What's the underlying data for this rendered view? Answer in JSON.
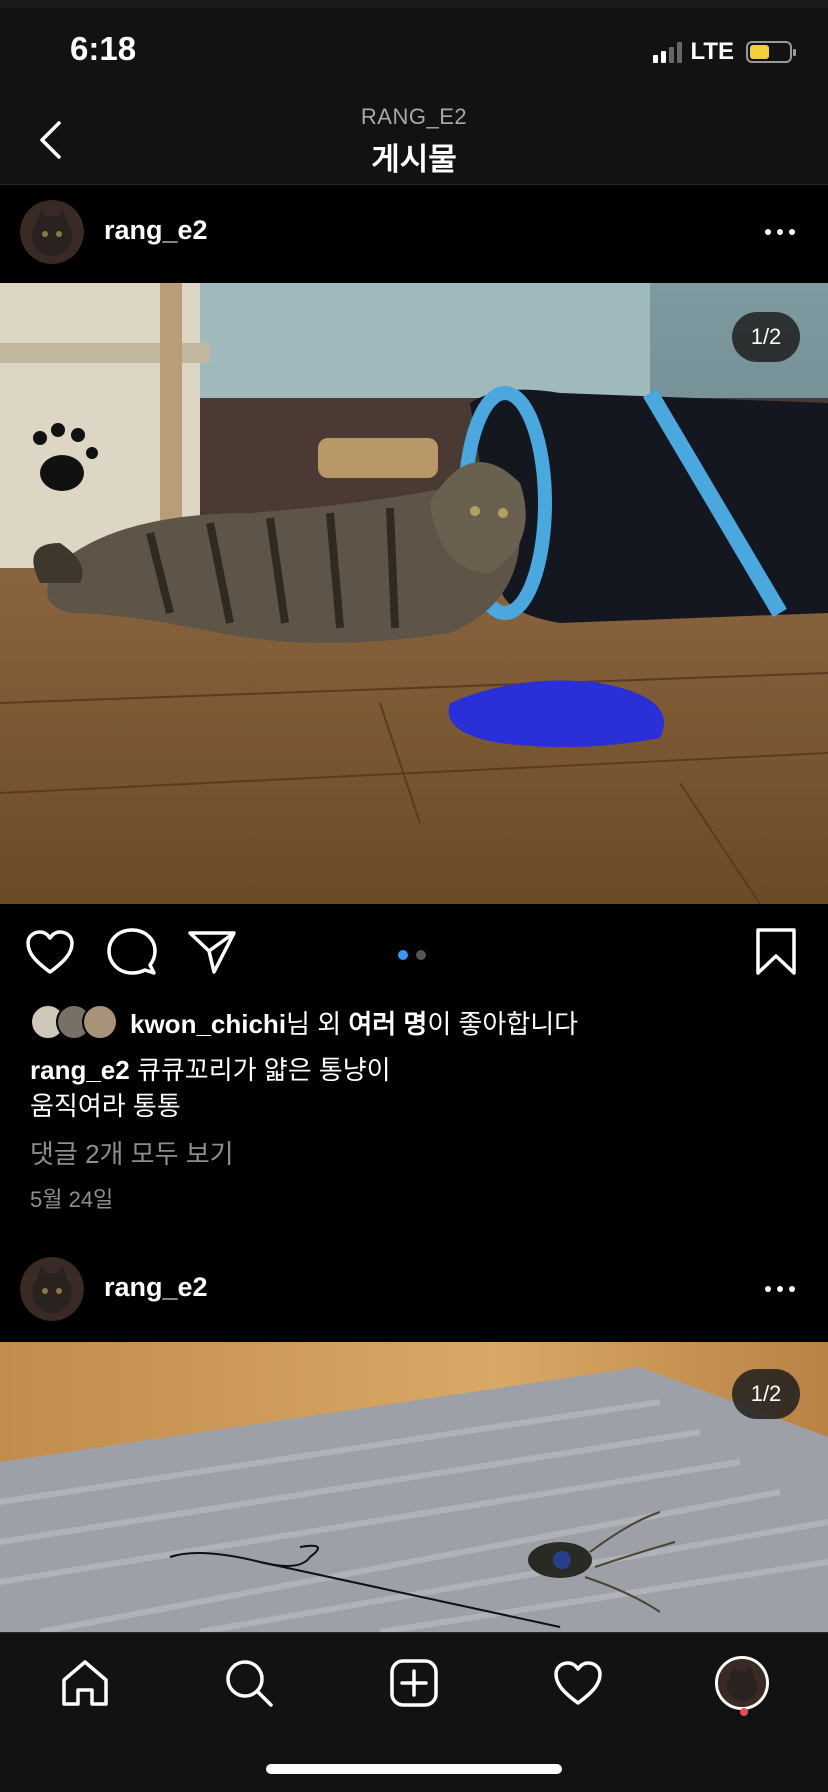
{
  "status_bar": {
    "time": "6:18",
    "network": "LTE",
    "battery_level": 0.5,
    "battery_color": "#f2d13a"
  },
  "nav": {
    "subtitle": "RANG_E2",
    "title": "게시물"
  },
  "posts": [
    {
      "username": "rang_e2",
      "image_counter": "1/2",
      "carousel_total": 2,
      "carousel_active": 1,
      "liked_by_user": "kwon_chichi",
      "likes_suffix_1": "님 외 ",
      "likes_bold_2": "여러 명",
      "likes_suffix_2": "이 좋아합니다",
      "caption_username": "rang_e2",
      "caption_line1": " 큐큐꼬리가 얇은 통냥이",
      "caption_line2": "움직여라 통통",
      "view_comments": "댓글 2개 모두 보기",
      "date": "5월 24일"
    },
    {
      "username": "rang_e2",
      "image_counter": "1/2"
    }
  ],
  "colors": {
    "accent": "#3897f0",
    "notification": "#ed4956"
  },
  "icons": {
    "back": "chevron-left-icon",
    "more": "more-icon",
    "like": "heart-icon",
    "comment": "comment-icon",
    "share": "send-icon",
    "save": "bookmark-icon",
    "home": "home-icon",
    "search": "search-icon",
    "create": "plus-square-icon",
    "activity": "heart-icon",
    "profile": "profile-avatar"
  }
}
